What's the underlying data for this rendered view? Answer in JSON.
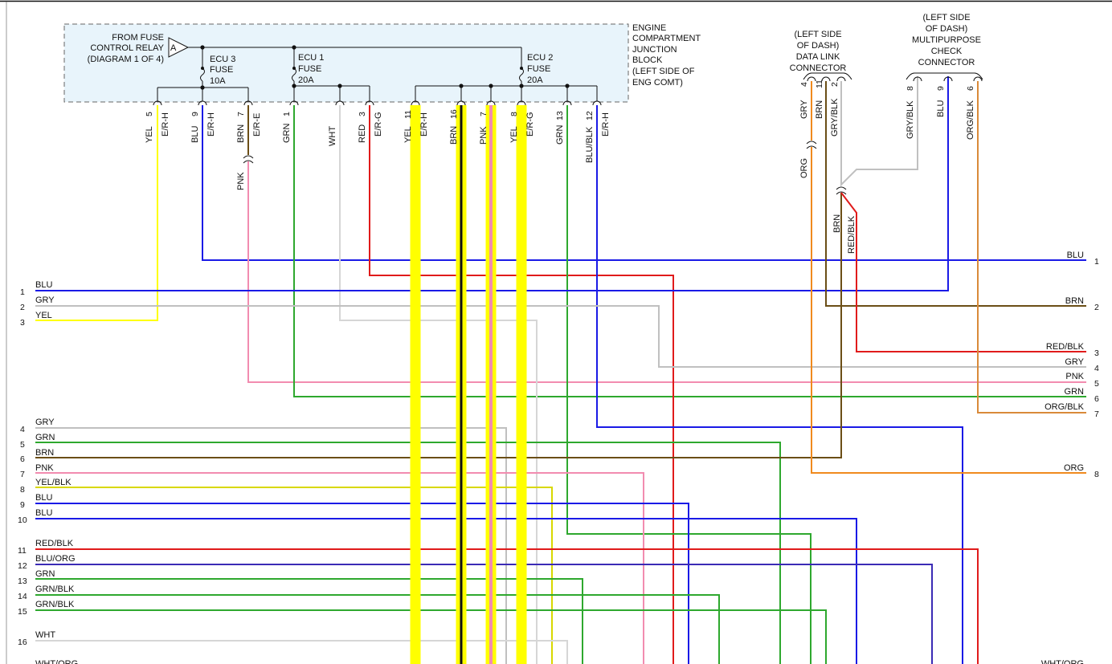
{
  "junction_block": {
    "from_relay": [
      "FROM FUSE",
      "CONTROL RELAY",
      "(DIAGRAM 1 OF 4)"
    ],
    "relay_tag": "A",
    "title": [
      "ENGINE",
      "COMPARTMENT",
      "JUNCTION",
      "BLOCK",
      "(LEFT SIDE OF",
      "ENG COMT)"
    ],
    "fuses": [
      {
        "lines": [
          "ECU 3",
          "FUSE",
          "10A"
        ]
      },
      {
        "lines": [
          "ECU 1",
          "FUSE",
          "20A"
        ]
      },
      {
        "lines": [
          "ECU 2",
          "FUSE",
          "20A"
        ]
      }
    ],
    "terminals": [
      {
        "pin": "5",
        "conn": "E/R-H",
        "wire": "YEL"
      },
      {
        "pin": "9",
        "conn": "E/R-H",
        "wire": "BLU"
      },
      {
        "pin": "7",
        "conn": "E/R-E",
        "wire": "BRN"
      },
      {
        "pin": "1",
        "conn": "",
        "wire": "GRN"
      },
      {
        "pin": "",
        "conn": "",
        "wire": "WHT"
      },
      {
        "pin": "3",
        "conn": "E/R-G",
        "wire": "RED"
      },
      {
        "pin": "11",
        "conn": "E/R-H",
        "wire": "YEL"
      },
      {
        "pin": "16",
        "conn": "",
        "wire": "BRN"
      },
      {
        "pin": "7",
        "conn": "",
        "wire": "PNK"
      },
      {
        "pin": "8",
        "conn": "E/R-G",
        "wire": "YEL"
      },
      {
        "pin": "13",
        "conn": "",
        "wire": "GRN"
      },
      {
        "pin": "12",
        "conn": "E/R-H",
        "wire": "BLU/BLK"
      }
    ],
    "pnk_splice_label": "PNK"
  },
  "data_link_connector": {
    "title": [
      "(LEFT SIDE",
      "OF DASH)",
      "DATA LINK",
      "CONNECTOR"
    ],
    "pins": [
      {
        "pin": "4",
        "wire": "GRY"
      },
      {
        "pin": "11",
        "wire": "BRN"
      },
      {
        "pin": "2",
        "wire": "GRY/BLK"
      }
    ],
    "org_label": "ORG",
    "splice_labels": [
      "BRN",
      "RED/BLK"
    ]
  },
  "multipurpose_connector": {
    "title": [
      "(LEFT SIDE",
      "OF DASH)",
      "MULTIPURPOSE",
      "CHECK",
      "CONNECTOR"
    ],
    "pins": [
      {
        "pin": "8",
        "wire": "GRY/BLK"
      },
      {
        "pin": "9",
        "wire": "BLU"
      },
      {
        "pin": "6",
        "wire": "ORG/BLK"
      }
    ]
  },
  "left_wires": [
    {
      "num": "1",
      "color": "BLU"
    },
    {
      "num": "2",
      "color": "GRY"
    },
    {
      "num": "3",
      "color": "YEL"
    },
    {
      "num": "4",
      "color": "GRY"
    },
    {
      "num": "5",
      "color": "GRN"
    },
    {
      "num": "6",
      "color": "BRN"
    },
    {
      "num": "7",
      "color": "PNK"
    },
    {
      "num": "8",
      "color": "YEL/BLK"
    },
    {
      "num": "9",
      "color": "BLU"
    },
    {
      "num": "10",
      "color": "BLU"
    },
    {
      "num": "11",
      "color": "RED/BLK"
    },
    {
      "num": "12",
      "color": "BLU/ORG"
    },
    {
      "num": "13",
      "color": "GRN"
    },
    {
      "num": "14",
      "color": "GRN/BLK"
    },
    {
      "num": "15",
      "color": "GRN/BLK"
    },
    {
      "num": "16",
      "color": "WHT"
    },
    {
      "num": "",
      "color": "WHT/ORG"
    }
  ],
  "right_wires": [
    {
      "num": "1",
      "color": "BLU"
    },
    {
      "num": "2",
      "color": "BRN"
    },
    {
      "num": "3",
      "color": "RED/BLK"
    },
    {
      "num": "4",
      "color": "GRY"
    },
    {
      "num": "5",
      "color": "PNK"
    },
    {
      "num": "6",
      "color": "GRN"
    },
    {
      "num": "7",
      "color": "ORG/BLK"
    },
    {
      "num": "8",
      "color": "ORG"
    },
    {
      "num": "",
      "color": "WHT/ORG"
    }
  ],
  "wire_colors": {
    "BLU": "#1a1ae6",
    "GRY": "#c0c0c0",
    "YEL": "#ffff00",
    "GRN": "#2ea82e",
    "BRN": "#6b4e16",
    "PNK": "#f28cb0",
    "RED": "#e01b1b",
    "WHT": "#d6d6d6",
    "ORG": "#f08a1e",
    "ORG_BLK": "#d98a3a",
    "YEL_BLK": "#d8d800",
    "BLK": "#111111",
    "junction_fill": "#e8f4fb"
  }
}
